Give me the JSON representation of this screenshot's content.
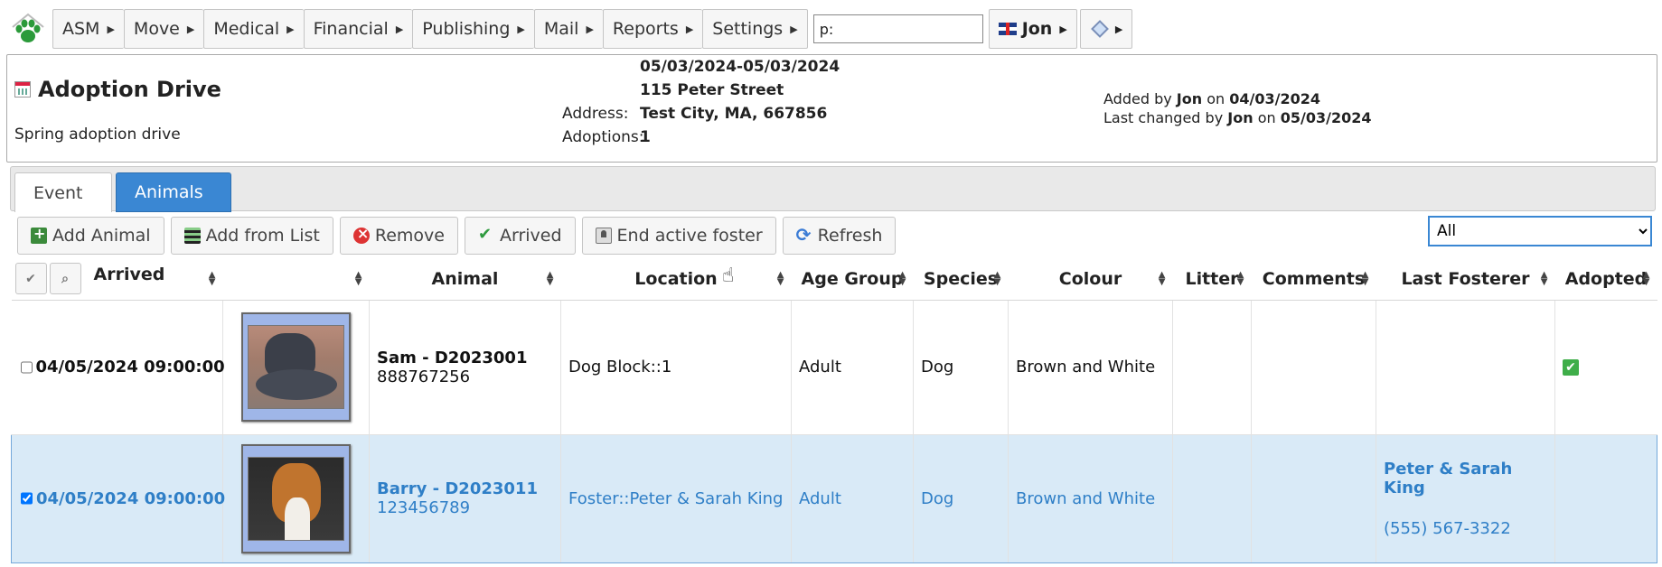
{
  "menu": {
    "items": [
      "ASM",
      "Move",
      "Medical",
      "Financial",
      "Publishing",
      "Mail",
      "Reports",
      "Settings"
    ],
    "search_value": "p:",
    "user": "Jon"
  },
  "event": {
    "title": "Adoption Drive",
    "description": "Spring adoption drive",
    "dates": "05/03/2024-05/03/2024",
    "street": "115 Peter Street",
    "address_label": "Address:",
    "address_city": "Test City, MA, 667856",
    "adoptions_label": "Adoptions:",
    "adoptions_value": "1",
    "added_prefix": "Added by",
    "added_by": "Jon",
    "added_on_word": "on",
    "added_date": "04/03/2024",
    "changed_prefix": "Last changed by",
    "changed_by": "Jon",
    "changed_on_word": "on",
    "changed_date": "05/03/2024"
  },
  "tabs": [
    {
      "label": "Event",
      "active": false
    },
    {
      "label": "Animals",
      "active": true
    }
  ],
  "toolbar": {
    "add_animal": "Add Animal",
    "add_from_list": "Add from List",
    "remove": "Remove",
    "arrived": "Arrived",
    "end_foster": "End active foster",
    "refresh": "Refresh"
  },
  "filter": {
    "selected": "All"
  },
  "table": {
    "columns": [
      "Arrived",
      "",
      "Animal",
      "Location",
      "Age Group",
      "Species",
      "Colour",
      "Litter",
      "Comments",
      "Last Fosterer",
      "Adopted"
    ],
    "rows": [
      {
        "checked": false,
        "arrived": "04/05/2024 09:00:00",
        "animal_name": "Sam - D2023001",
        "animal_code": "888767256",
        "location": "Dog Block::1",
        "age_group": "Adult",
        "species": "Dog",
        "colour": "Brown and White",
        "litter": "",
        "comments": "",
        "fosterer_name": "",
        "fosterer_phone": "",
        "adopted": true
      },
      {
        "checked": true,
        "arrived": "04/05/2024 09:00:00",
        "animal_name": "Barry - D2023011",
        "animal_code": "123456789",
        "location": "Foster::Peter & Sarah King",
        "age_group": "Adult",
        "species": "Dog",
        "colour": "Brown and White",
        "litter": "",
        "comments": "",
        "fosterer_name": "Peter & Sarah King",
        "fosterer_phone": "(555) 567-3322",
        "adopted": false
      }
    ]
  },
  "colors": {
    "accent": "#3a87d3",
    "selected_row": "#d9eaf7",
    "link_text": "#2f7fc7"
  },
  "icons": [
    "paw-logo-icon",
    "calendar-icon",
    "flag-uk-icon",
    "help-diamond-icon",
    "add-animal-icon",
    "add-list-icon",
    "remove-icon",
    "check-icon",
    "foster-icon",
    "refresh-icon",
    "hand-cursor-icon"
  ]
}
